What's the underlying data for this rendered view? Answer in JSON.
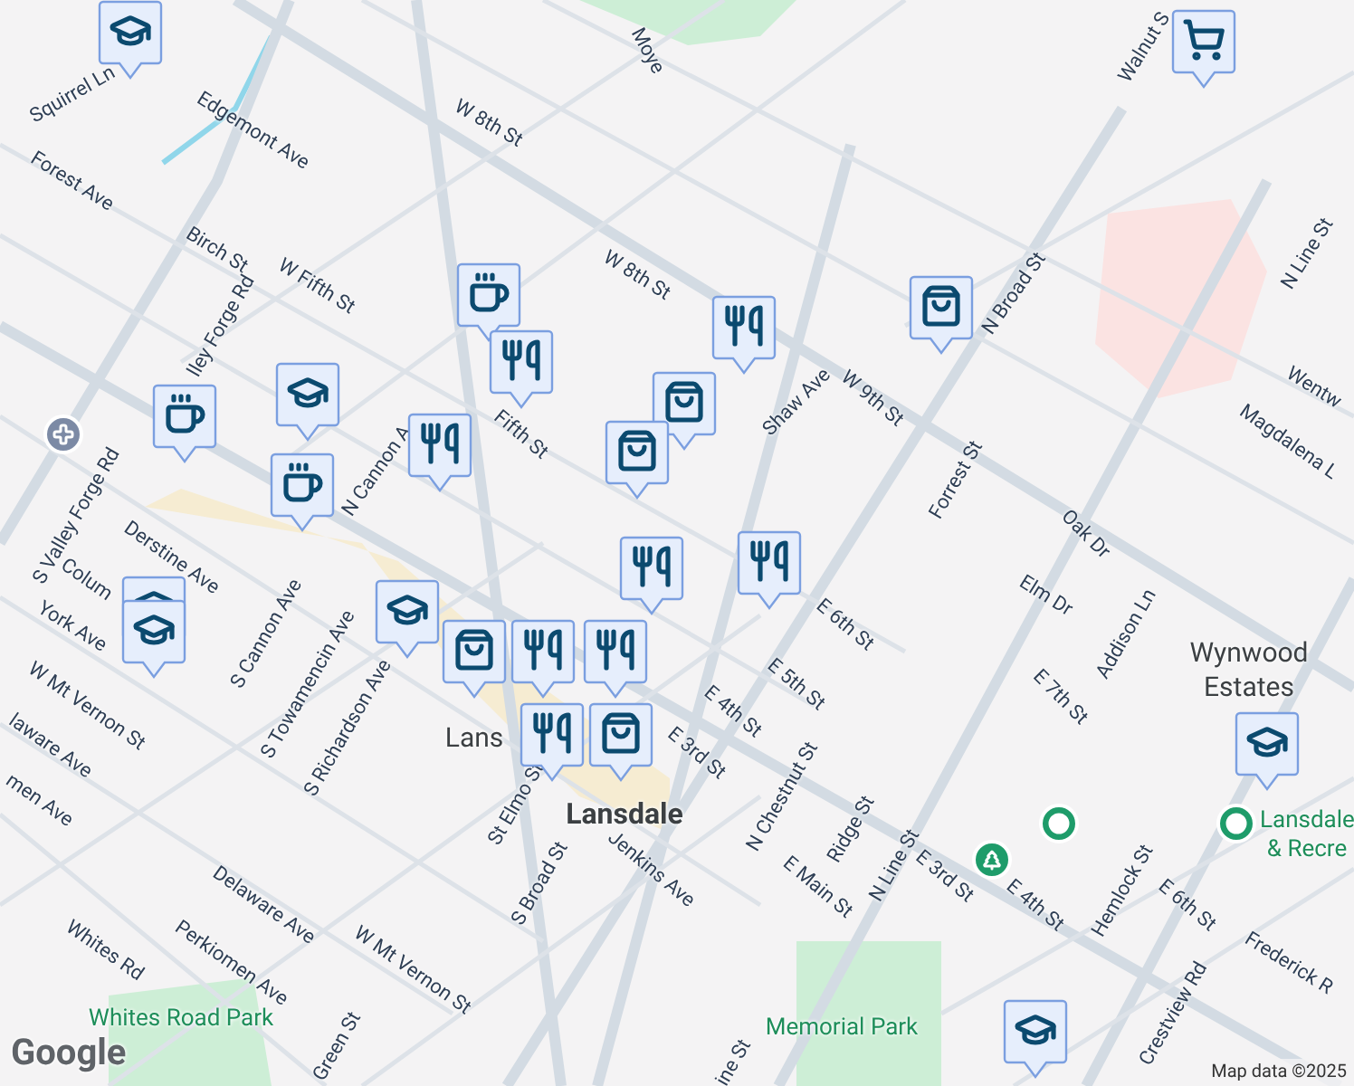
{
  "map": {
    "labels": [
      {
        "text": "W 8th St",
        "kind": "street"
      },
      {
        "text": "Moye",
        "kind": "street"
      },
      {
        "text": "Squirrel Ln",
        "kind": "street"
      },
      {
        "text": "Edgemont Ave",
        "kind": "street"
      },
      {
        "text": "Forest Ave",
        "kind": "street"
      },
      {
        "text": "Birch St",
        "kind": "street"
      },
      {
        "text": "W Fifth St",
        "kind": "street"
      },
      {
        "text": "W 8th St",
        "kind": "street"
      },
      {
        "text": "lley Forge Rd",
        "kind": "street"
      },
      {
        "text": "Walnut S",
        "kind": "street"
      },
      {
        "text": "N Broad St",
        "kind": "street"
      },
      {
        "text": "N Line St",
        "kind": "street"
      },
      {
        "text": "Wentw",
        "kind": "street"
      },
      {
        "text": "Magdalena L",
        "kind": "street"
      },
      {
        "text": "Shaw Ave",
        "kind": "street"
      },
      {
        "text": "W 9th St",
        "kind": "street"
      },
      {
        "text": "Fifth St",
        "kind": "street"
      },
      {
        "text": "Forrest St",
        "kind": "street"
      },
      {
        "text": "Oak Dr",
        "kind": "street"
      },
      {
        "text": "Elm Dr",
        "kind": "street"
      },
      {
        "text": "Addison Ln",
        "kind": "street"
      },
      {
        "text": "E 6th St",
        "kind": "street"
      },
      {
        "text": "E 7th St",
        "kind": "street"
      },
      {
        "text": "E 5th St",
        "kind": "street"
      },
      {
        "text": "E 4th St",
        "kind": "street"
      },
      {
        "text": "E 3rd St",
        "kind": "street"
      },
      {
        "text": "N Chestnut St",
        "kind": "street"
      },
      {
        "text": "Ridge St",
        "kind": "street"
      },
      {
        "text": "E Main St",
        "kind": "street"
      },
      {
        "text": "N Line St",
        "kind": "street"
      },
      {
        "text": "E 3rd St",
        "kind": "street"
      },
      {
        "text": "E 4th St",
        "kind": "street"
      },
      {
        "text": "E 6th St",
        "kind": "street"
      },
      {
        "text": "Hemlock St",
        "kind": "street"
      },
      {
        "text": "Crestview Rd",
        "kind": "street"
      },
      {
        "text": "Frederick R",
        "kind": "street"
      },
      {
        "text": "Wynwood Estates",
        "kind": "place"
      },
      {
        "text": "Lansdale",
        "kind": "city"
      },
      {
        "text": "Lansdale & Recre",
        "kind": "park"
      },
      {
        "text": "Lans",
        "kind": "place"
      },
      {
        "text": "Derstine Ave",
        "kind": "street"
      },
      {
        "text": "Colum",
        "kind": "street"
      },
      {
        "text": "S Valley Forge Rd",
        "kind": "street"
      },
      {
        "text": "N Cannon A",
        "kind": "street"
      },
      {
        "text": "York Ave",
        "kind": "street"
      },
      {
        "text": "W Mt Vernon St",
        "kind": "street"
      },
      {
        "text": "laware Ave",
        "kind": "street"
      },
      {
        "text": "men Ave",
        "kind": "street"
      },
      {
        "text": "S Cannon Ave",
        "kind": "street"
      },
      {
        "text": "S Towamencin Ave",
        "kind": "street"
      },
      {
        "text": "S Richardson Ave",
        "kind": "street"
      },
      {
        "text": "St Elmo St",
        "kind": "street"
      },
      {
        "text": "S Broad St",
        "kind": "street"
      },
      {
        "text": "Jenkins Ave",
        "kind": "street"
      },
      {
        "text": "Delaware Ave",
        "kind": "street"
      },
      {
        "text": "Perkiomen Ave",
        "kind": "street"
      },
      {
        "text": "W Mt Vernon St",
        "kind": "street"
      },
      {
        "text": "Whites Rd",
        "kind": "street"
      },
      {
        "text": "Whites Road Park",
        "kind": "park"
      },
      {
        "text": "Green St",
        "kind": "street"
      },
      {
        "text": "Memorial Park",
        "kind": "park"
      },
      {
        "text": "ine St",
        "kind": "street"
      }
    ],
    "markers": [
      {
        "kind": "school"
      },
      {
        "kind": "cart"
      },
      {
        "kind": "coffee"
      },
      {
        "kind": "dining"
      },
      {
        "kind": "school"
      },
      {
        "kind": "coffee"
      },
      {
        "kind": "dining"
      },
      {
        "kind": "coffee"
      },
      {
        "kind": "shopping"
      },
      {
        "kind": "shopping"
      },
      {
        "kind": "shopping"
      },
      {
        "kind": "dining"
      },
      {
        "kind": "dining"
      },
      {
        "kind": "dining"
      },
      {
        "kind": "school"
      },
      {
        "kind": "school"
      },
      {
        "kind": "school"
      },
      {
        "kind": "shopping"
      },
      {
        "kind": "dining"
      },
      {
        "kind": "dining"
      },
      {
        "kind": "dining"
      },
      {
        "kind": "shopping"
      },
      {
        "kind": "school"
      },
      {
        "kind": "school"
      }
    ],
    "pins": [
      {
        "kind": "church"
      },
      {
        "kind": "tree"
      },
      {
        "kind": "place"
      },
      {
        "kind": "place"
      }
    ],
    "attribution": "Map data ©2025",
    "logo": "Google"
  }
}
